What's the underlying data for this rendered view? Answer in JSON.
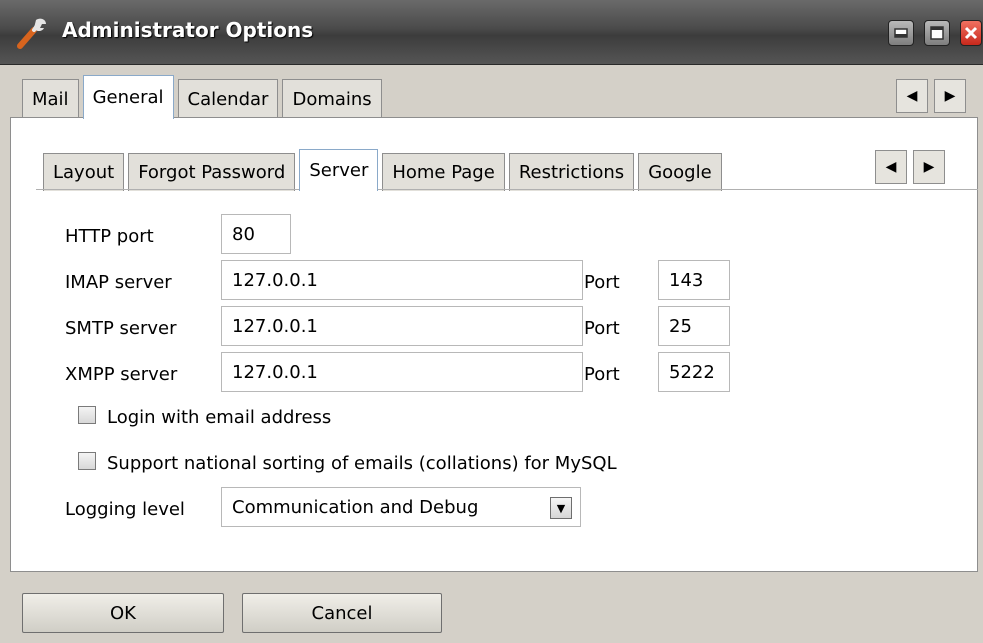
{
  "window": {
    "title": "Administrator Options",
    "controls": {
      "minimize": "minimize",
      "maximize": "maximize",
      "close": "close"
    }
  },
  "outer_tabs": [
    {
      "label": "Mail",
      "active": false
    },
    {
      "label": "General",
      "active": true
    },
    {
      "label": "Calendar",
      "active": false
    },
    {
      "label": "Domains",
      "active": false
    }
  ],
  "inner_tabs": [
    {
      "label": "Layout",
      "active": false
    },
    {
      "label": "Forgot Password",
      "active": false
    },
    {
      "label": "Server",
      "active": true
    },
    {
      "label": "Home Page",
      "active": false
    },
    {
      "label": "Restrictions",
      "active": false
    },
    {
      "label": "Google",
      "active": false
    }
  ],
  "scroll_arrows": {
    "left": "◀",
    "right": "▶"
  },
  "form": {
    "http_port_label": "HTTP port",
    "http_port_value": "80",
    "imap_label": "IMAP server",
    "imap_value": "127.0.0.1",
    "imap_port_label": "Port",
    "imap_port_value": "143",
    "smtp_label": "SMTP server",
    "smtp_value": "127.0.0.1",
    "smtp_port_label": "Port",
    "smtp_port_value": "25",
    "xmpp_label": "XMPP server",
    "xmpp_value": "127.0.0.1",
    "xmpp_port_label": "Port",
    "xmpp_port_value": "5222",
    "login_email_label": "Login with email address",
    "login_email_checked": false,
    "national_sort_label": "Support national sorting of emails (collations) for MySQL",
    "national_sort_checked": false,
    "logging_label": "Logging level",
    "logging_value": "Communication and Debug"
  },
  "buttons": {
    "ok": "OK",
    "cancel": "Cancel"
  },
  "icons": {
    "app": "wrench-icon",
    "dropdown": "chevron-down-icon"
  },
  "colors": {
    "titlebar": "#4a4a4a",
    "close": "#d43a2c",
    "active_tab_border": "#8aa9c9"
  }
}
